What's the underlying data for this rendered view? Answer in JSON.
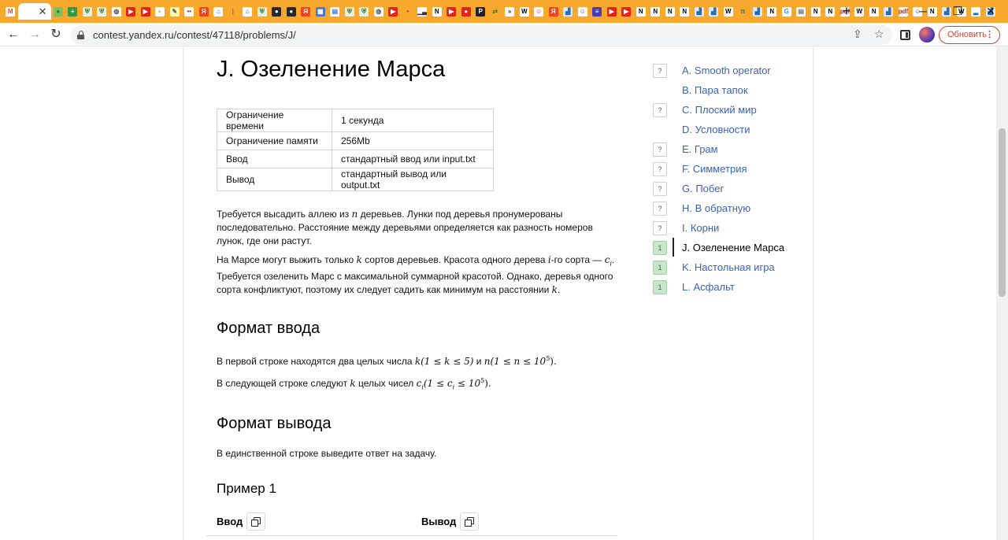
{
  "browser": {
    "tabstrip_color": "#f8a82d",
    "favicons": [
      {
        "icon": "gmail-icon",
        "glyph": "M",
        "color": "#ea4335",
        "bg": "#ffffff"
      },
      {
        "icon": "active-tab-icon",
        "glyph": "",
        "color": "#333",
        "bg": "#ffffff",
        "active": true
      },
      {
        "icon": "globe-icon",
        "glyph": "●",
        "color": "#2e7d32",
        "bg": "#7fbf5f"
      },
      {
        "icon": "plus-green-icon",
        "glyph": "+",
        "color": "#fff",
        "bg": "#2e9d3d"
      },
      {
        "icon": "shield-icon",
        "glyph": "⛨",
        "color": "#3a6f3a",
        "bg": "#e7f0d8"
      },
      {
        "icon": "shield-icon",
        "glyph": "⛨",
        "color": "#3a6f3a",
        "bg": "#e7f0d8"
      },
      {
        "icon": "globe-icon",
        "glyph": "◍",
        "color": "#555",
        "bg": "#ffffff"
      },
      {
        "icon": "youtube-icon",
        "glyph": "▶",
        "color": "#fff",
        "bg": "#e62117"
      },
      {
        "icon": "youtube-icon",
        "glyph": "▶",
        "color": "#fff",
        "bg": "#e62117"
      },
      {
        "icon": "yandex-disk-icon",
        "glyph": "◐",
        "color": "#e6a817",
        "bg": "#ffffff"
      },
      {
        "icon": "pencil-icon",
        "glyph": "✎",
        "color": "#555",
        "bg": "#fff6b0"
      },
      {
        "icon": "dots-icon",
        "glyph": "••",
        "color": "#c62828",
        "bg": "#ffffff"
      },
      {
        "icon": "yandex-icon",
        "glyph": "Я",
        "color": "#fff",
        "bg": "#fc3f1d"
      },
      {
        "icon": "home-icon",
        "glyph": "⌂",
        "color": "#1e5aa8",
        "bg": "#ffffff"
      },
      {
        "icon": "bar-icon",
        "glyph": "|",
        "color": "#777",
        "bg": "#f8a82d"
      },
      {
        "icon": "home-icon",
        "glyph": "⌂",
        "color": "#1e5aa8",
        "bg": "#ffffff"
      },
      {
        "icon": "shield-icon",
        "glyph": "⛨",
        "color": "#3a6f3a",
        "bg": "#e7f0d8"
      },
      {
        "icon": "github-icon",
        "glyph": "●",
        "color": "#fff",
        "bg": "#24292e"
      },
      {
        "icon": "github-icon",
        "glyph": "●",
        "color": "#fff",
        "bg": "#24292e"
      },
      {
        "icon": "yandex-icon",
        "glyph": "Я",
        "color": "#fff",
        "bg": "#fc3f1d"
      },
      {
        "icon": "calendar-icon",
        "glyph": "▦",
        "color": "#fff",
        "bg": "#4a76d1"
      },
      {
        "icon": "doc-icon",
        "glyph": "▤",
        "color": "#4a76d1",
        "bg": "#ffffff"
      },
      {
        "icon": "shield-icon",
        "glyph": "⛨",
        "color": "#3a6f3a",
        "bg": "#e7f0d8"
      },
      {
        "icon": "shield-icon",
        "glyph": "⛨",
        "color": "#3a6f3a",
        "bg": "#e7f0d8"
      },
      {
        "icon": "globe-icon",
        "glyph": "◍",
        "color": "#555",
        "bg": "#ffffff"
      },
      {
        "icon": "youtube-icon",
        "glyph": "▶",
        "color": "#fff",
        "bg": "#e62117"
      },
      {
        "icon": "dots-icon",
        "glyph": "•",
        "color": "#c62828",
        "bg": "#f8a82d"
      },
      {
        "icon": "chart-icon",
        "glyph": "▁▃",
        "color": "#333",
        "bg": "#ffffff"
      },
      {
        "icon": "notion-icon",
        "glyph": "N",
        "color": "#000",
        "bg": "#ffffff"
      },
      {
        "icon": "youtube-icon",
        "glyph": "▶",
        "color": "#fff",
        "bg": "#e62117"
      },
      {
        "icon": "red-icon",
        "glyph": "●",
        "color": "#fff",
        "bg": "#e62117"
      },
      {
        "icon": "p-icon",
        "glyph": "P",
        "color": "#fff",
        "bg": "#222222"
      },
      {
        "icon": "arrows-icon",
        "glyph": "⇄",
        "color": "#2e7d32",
        "bg": "#f8a82d"
      },
      {
        "icon": "chevron-icon",
        "glyph": "»",
        "color": "#333",
        "bg": "#ffffff"
      },
      {
        "icon": "wikipedia-icon",
        "glyph": "W",
        "color": "#000",
        "bg": "#ffffff"
      },
      {
        "icon": "person-icon",
        "glyph": "☺",
        "color": "#c62828",
        "bg": "#ffffff"
      },
      {
        "icon": "yandex-icon",
        "glyph": "Я",
        "color": "#fff",
        "bg": "#fc3f1d"
      },
      {
        "icon": "image-icon",
        "glyph": "▟",
        "color": "#2b6cb0",
        "bg": "#dce9f7"
      },
      {
        "icon": "person-icon",
        "glyph": "☺",
        "color": "#555",
        "bg": "#ffffff"
      },
      {
        "icon": "list-icon",
        "glyph": "≡",
        "color": "#fff",
        "bg": "#4b3ab0"
      },
      {
        "icon": "youtube-icon",
        "glyph": "▶",
        "color": "#fff",
        "bg": "#e62117"
      },
      {
        "icon": "youtube-icon",
        "glyph": "▶",
        "color": "#fff",
        "bg": "#e62117"
      },
      {
        "icon": "notion-icon",
        "glyph": "N",
        "color": "#000",
        "bg": "#ffffff"
      },
      {
        "icon": "notion-icon",
        "glyph": "N",
        "color": "#000",
        "bg": "#ffffff"
      },
      {
        "icon": "notion-icon",
        "glyph": "N",
        "color": "#000",
        "bg": "#ffffff"
      },
      {
        "icon": "notion-icon",
        "glyph": "N",
        "color": "#000",
        "bg": "#ffffff"
      },
      {
        "icon": "image-icon",
        "glyph": "▟",
        "color": "#2b6cb0",
        "bg": "#dce9f7"
      },
      {
        "icon": "image-icon",
        "glyph": "▟",
        "color": "#2b6cb0",
        "bg": "#dce9f7"
      },
      {
        "icon": "wikipedia-icon",
        "glyph": "W",
        "color": "#000",
        "bg": "#ffffff"
      },
      {
        "icon": "pi-icon",
        "glyph": "π",
        "color": "#2e7d32",
        "bg": "#f8a82d"
      },
      {
        "icon": "image-icon",
        "glyph": "▟",
        "color": "#2b6cb0",
        "bg": "#dce9f7"
      },
      {
        "icon": "notion-icon",
        "glyph": "N",
        "color": "#000",
        "bg": "#ffffff"
      },
      {
        "icon": "google-icon",
        "glyph": "G",
        "color": "#4285f4",
        "bg": "#ffffff"
      },
      {
        "icon": "doc-icon",
        "glyph": "▤",
        "color": "#777",
        "bg": "#ffffff"
      },
      {
        "icon": "notion-icon",
        "glyph": "N",
        "color": "#000",
        "bg": "#ffffff"
      },
      {
        "icon": "notion-icon",
        "glyph": "N",
        "color": "#000",
        "bg": "#ffffff"
      },
      {
        "icon": "pdf-icon",
        "glyph": "pdf",
        "color": "#c62828",
        "bg": "#ffffff"
      },
      {
        "icon": "wikipedia-icon",
        "glyph": "W",
        "color": "#000",
        "bg": "#ffffff"
      },
      {
        "icon": "notion-icon",
        "glyph": "N",
        "color": "#000",
        "bg": "#ffffff"
      },
      {
        "icon": "image-icon",
        "glyph": "▟",
        "color": "#2b6cb0",
        "bg": "#dce9f7"
      },
      {
        "icon": "pdf-icon",
        "glyph": "pdf",
        "color": "#c62828",
        "bg": "#ffffff"
      },
      {
        "icon": "person-icon",
        "glyph": "☺",
        "color": "#555",
        "bg": "#ffffff"
      },
      {
        "icon": "notion-icon",
        "glyph": "N",
        "color": "#000",
        "bg": "#ffffff"
      },
      {
        "icon": "image-icon",
        "glyph": "▟",
        "color": "#2b6cb0",
        "bg": "#dce9f7"
      },
      {
        "icon": "wikipedia-icon",
        "glyph": "W",
        "color": "#000",
        "bg": "#ffffff"
      },
      {
        "icon": "chart-icon",
        "glyph": "▂",
        "color": "#2b6cb0",
        "bg": "#ffffff"
      },
      {
        "icon": "image-icon",
        "glyph": "▟",
        "color": "#2b6cb0",
        "bg": "#dce9f7"
      }
    ],
    "new_tab_glyph": "+",
    "window_controls": {
      "minimize": "─",
      "restore": "❐",
      "close": "✕"
    },
    "nav": {
      "back": "←",
      "forward": "→",
      "reload": "↻"
    },
    "url": "contest.yandex.ru/contest/47118/problems/J/",
    "omnibox_icons": {
      "share": "⇪",
      "star": "☆"
    },
    "update_button": "Обновить",
    "update_dots": "⋮"
  },
  "problem": {
    "title": "J. Озеленение Марса",
    "limits": [
      {
        "key": "Ограничение времени",
        "value": "1 секунда"
      },
      {
        "key": "Ограничение памяти",
        "value": "256Mb"
      },
      {
        "key": "Ввод",
        "value": "стандартный ввод или input.txt"
      },
      {
        "key": "Вывод",
        "value": "стандартный вывод или output.txt"
      }
    ],
    "statement": {
      "p1_a": "Требуется высадить аллею из ",
      "p1_n": "n",
      "p1_b": " деревьев. Лунки под деревья пронумерованы последовательно. Расстояние между деревьями определяется как разность номеров лунок, где они растут.",
      "p2_a": "На Марсе могут выжить только ",
      "p2_k": "k",
      "p2_b": " сортов деревьев. Красота одного дерева ",
      "p2_i": "i",
      "p2_c": "-го сорта — ",
      "p2_ci": "c",
      "p2_ci_sub": "i",
      "p2_d": ". Требуется озеленить Марс с максимальной суммарной красотой. Однако, деревья одного сорта конфликтуют, поэтому их следует садить как минимум на расстоянии ",
      "p2_k2": "k",
      "p2_e": "."
    },
    "input_format": {
      "heading": "Формат ввода",
      "line1_a": "В первой строке находятся два целых числа ",
      "line1_math1": "k(1 ≤ k ≤ 5)",
      "line1_b": " и ",
      "line1_math2": "n(1 ≤ n ≤ 10",
      "line1_sup": "5",
      "line1_end": ").",
      "line2_a": "В следующей строке следуют ",
      "line2_k": "k",
      "line2_b": " целых чисел ",
      "line2_c": "c",
      "line2_c_sub": "i",
      "line2_math": "(1 ≤ c",
      "line2_math_sub": "i",
      "line2_math2": " ≤ 10",
      "line2_sup": "5",
      "line2_end": ")."
    },
    "output_format": {
      "heading": "Формат вывода",
      "text": "В единственной строке выведите ответ на задачу."
    },
    "example": {
      "heading": "Пример 1",
      "input_label": "Ввод",
      "output_label": "Вывод"
    }
  },
  "problems_nav": [
    {
      "letter_label": "A. Smooth operator",
      "badge": "?",
      "status": "unknown"
    },
    {
      "letter_label": "B. Пара тапок",
      "badge": "",
      "status": "none"
    },
    {
      "letter_label": "C. Плоский мир",
      "badge": "?",
      "status": "unknown"
    },
    {
      "letter_label": "D. Условности",
      "badge": "",
      "status": "none"
    },
    {
      "letter_label": "E. Грам",
      "badge": "?",
      "status": "unknown"
    },
    {
      "letter_label": "F. Симметрия",
      "badge": "?",
      "status": "unknown"
    },
    {
      "letter_label": "G. Побег",
      "badge": "?",
      "status": "unknown"
    },
    {
      "letter_label": "H. В обратную",
      "badge": "?",
      "status": "unknown"
    },
    {
      "letter_label": "I. Корни",
      "badge": "?",
      "status": "unknown"
    },
    {
      "letter_label": "J. Озеленение Марса",
      "badge": "1",
      "status": "ok",
      "current": true
    },
    {
      "letter_label": "K. Настольная игра",
      "badge": "1",
      "status": "ok"
    },
    {
      "letter_label": "L. Асфальт",
      "badge": "1",
      "status": "ok"
    }
  ],
  "colors": {
    "link": "#3a62b5",
    "ok_badge": "#c8e6c9",
    "update_accent": "#c5473a"
  }
}
